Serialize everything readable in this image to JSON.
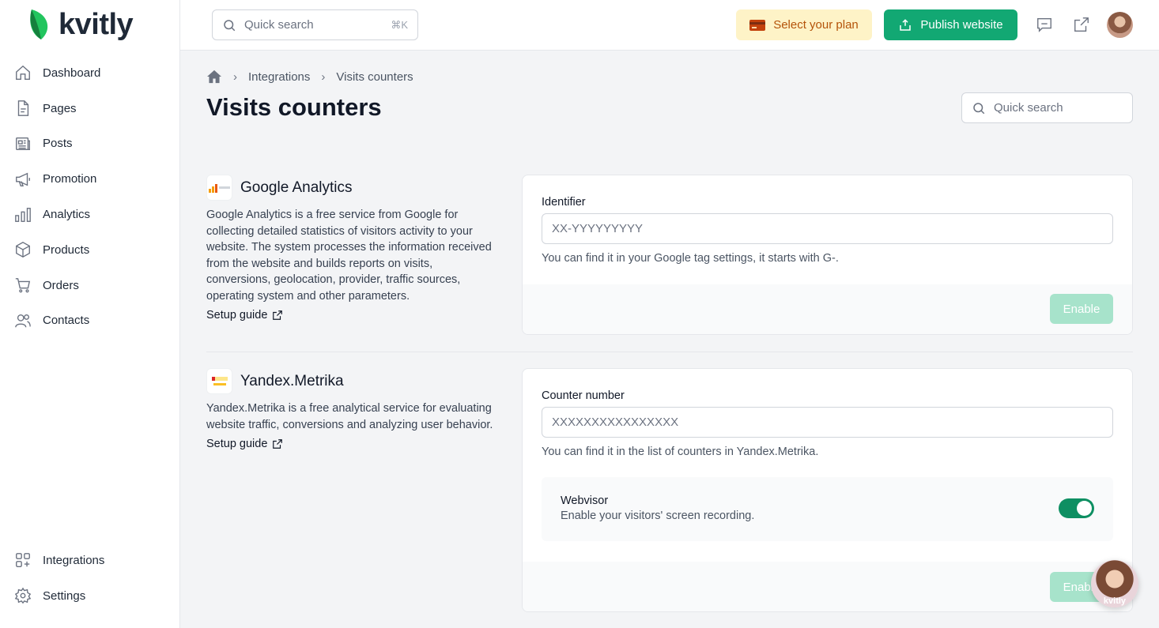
{
  "brand": {
    "name": "kvitly",
    "accent": "#12a873"
  },
  "sidebar": {
    "items": [
      {
        "label": "Dashboard",
        "icon": "home-icon"
      },
      {
        "label": "Pages",
        "icon": "page-icon"
      },
      {
        "label": "Posts",
        "icon": "posts-icon"
      },
      {
        "label": "Promotion",
        "icon": "megaphone-icon"
      },
      {
        "label": "Analytics",
        "icon": "bar-chart-icon"
      },
      {
        "label": "Products",
        "icon": "box-icon"
      },
      {
        "label": "Orders",
        "icon": "cart-icon"
      },
      {
        "label": "Contacts",
        "icon": "users-icon"
      }
    ],
    "bottom_items": [
      {
        "label": "Integrations",
        "icon": "integrations-icon"
      },
      {
        "label": "Settings",
        "icon": "gear-icon"
      }
    ]
  },
  "topbar": {
    "search_placeholder": "Quick search",
    "search_shortcut": "⌘K",
    "plan_label": "Select your plan",
    "publish_label": "Publish website"
  },
  "breadcrumb": {
    "level1": "Integrations",
    "level2": "Visits counters"
  },
  "page": {
    "title": "Visits counters",
    "search_placeholder": "Quick search"
  },
  "google": {
    "title": "Google Analytics",
    "description": "Google Analytics is a free service from Google for collecting detailed statistics of visitors activity to your website. The system processes the information received from the website and builds reports on visits, conversions, geolocation, provider, traffic sources, operating system and other parameters.",
    "setup_label": "Setup guide",
    "field_label": "Identifier",
    "placeholder": "XX-YYYYYYYYY",
    "hint": "You can find it in your Google tag settings, it starts with G-.",
    "enable_label": "Enable"
  },
  "yandex": {
    "title": "Yandex.Metrika",
    "description": "Yandex.Metrika is a free analytical service for evaluating website traffic, conversions and analyzing user behavior.",
    "setup_label": "Setup guide",
    "field_label": "Counter number",
    "placeholder": "XXXXXXXXXXXXXXXX",
    "hint": "You can find it in the list of counters in Yandex.Metrika.",
    "webvisor_title": "Webvisor",
    "webvisor_desc": "Enable your visitors' screen recording.",
    "webvisor_enabled": true,
    "enable_label": "Enable"
  },
  "chat": {
    "label": "kvitly"
  }
}
